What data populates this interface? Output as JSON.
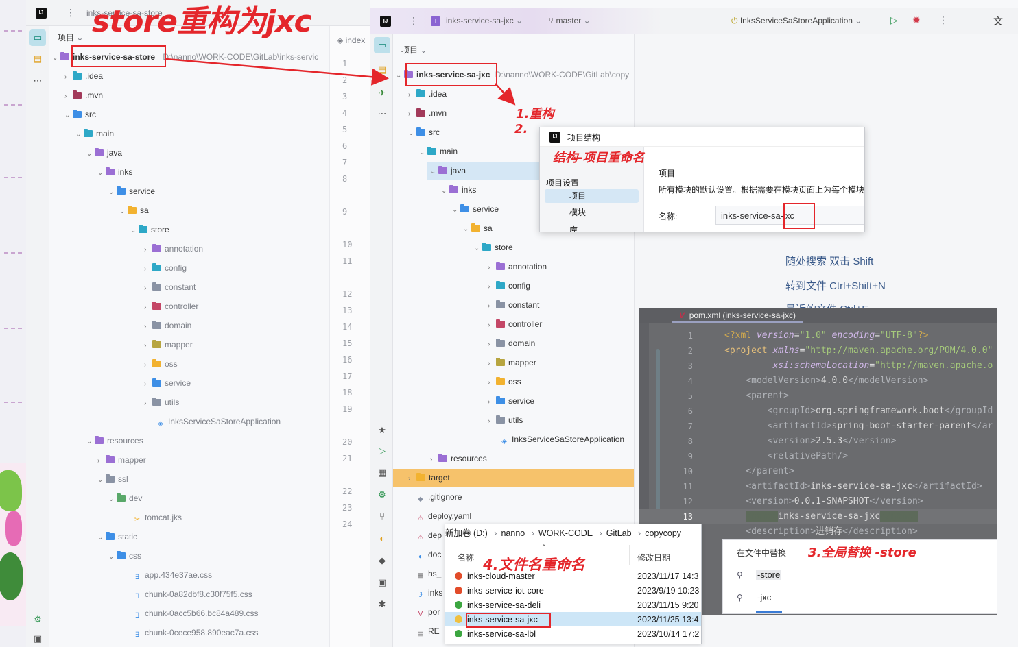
{
  "annotations": {
    "title": "store重构为jxc",
    "step1": "1.重构",
    "step2": "2.",
    "dialog_hint": "结构-项目重命名",
    "step3": "3.全局替换 -store",
    "step4": "4.文件名重命名"
  },
  "left_ide": {
    "project_name": "inks-service-sa-store",
    "project_path": "D:\\nanno\\WORK-CODE\\GitLab\\inks-servic",
    "panel_label": "项目",
    "tab_label": "index",
    "tree": [
      {
        "label": ".idea",
        "color": "#2ea8c7"
      },
      {
        "label": ".mvn",
        "color": "#a23a5a"
      },
      {
        "label": "src",
        "color": "#3e8fe6"
      },
      {
        "label": "main",
        "color": "#2ea8c7"
      },
      {
        "label": "java",
        "color": "#9b6fd4"
      },
      {
        "label": "inks",
        "color": "#9b6fd4"
      },
      {
        "label": "service",
        "color": "#3e8fe6"
      },
      {
        "label": "sa",
        "color": "#f2b230"
      },
      {
        "label": "store",
        "color": "#2ea8c7"
      },
      {
        "label": "annotation",
        "color": "#9b6fd4"
      },
      {
        "label": "config",
        "color": "#2ea8c7"
      },
      {
        "label": "constant",
        "color": "#8a93a4"
      },
      {
        "label": "controller",
        "color": "#c44767"
      },
      {
        "label": "domain",
        "color": "#8a93a4"
      },
      {
        "label": "mapper",
        "color": "#b7a540"
      },
      {
        "label": "oss",
        "color": "#f2b230"
      },
      {
        "label": "service",
        "color": "#3e8fe6"
      },
      {
        "label": "utils",
        "color": "#8a93a4"
      },
      {
        "label": "InksServiceSaStoreApplication",
        "color": "#3e8fe6"
      },
      {
        "label": "resources",
        "color": "#9b6fd4"
      },
      {
        "label": "mapper",
        "color": "#9b6fd4"
      },
      {
        "label": "ssl",
        "color": "#8a93a4"
      },
      {
        "label": "dev",
        "color": "#59a869"
      },
      {
        "label": "tomcat.jks",
        "color": "#f2b230"
      },
      {
        "label": "static",
        "color": "#3e8fe6"
      },
      {
        "label": "css",
        "color": "#3e8fe6"
      },
      {
        "label": "app.434e37ae.css",
        "color": "#3e8fe6"
      },
      {
        "label": "chunk-0a82dbf8.c30f75f5.css",
        "color": "#3e8fe6"
      },
      {
        "label": "chunk-0acc5b66.bc84a489.css",
        "color": "#3e8fe6"
      },
      {
        "label": "chunk-0cece958.890eac7a.css",
        "color": "#3e8fe6"
      }
    ],
    "line_numbers": [
      "1",
      "2",
      "3",
      "4",
      "5",
      "6",
      "7",
      "8",
      "9",
      "10",
      "11",
      "12",
      "13",
      "14",
      "15",
      "16",
      "17",
      "18",
      "19",
      "20",
      "21",
      "22",
      "23",
      "24"
    ]
  },
  "right_ide": {
    "project_chip": "inks-service-sa-jxc",
    "branch": "master",
    "run_config": "InksServiceSaStoreApplication",
    "panel_label": "项目",
    "project_name": "inks-service-sa-jxc",
    "project_path": "D:\\nanno\\WORK-CODE\\GitLab\\copy",
    "tree": [
      {
        "label": ".idea",
        "color": "#2ea8c7"
      },
      {
        "label": ".mvn",
        "color": "#a23a5a"
      },
      {
        "label": "src",
        "color": "#3e8fe6"
      },
      {
        "label": "main",
        "color": "#2ea8c7"
      },
      {
        "label": "java",
        "color": "#9b6fd4"
      },
      {
        "label": "inks",
        "color": "#9b6fd4"
      },
      {
        "label": "service",
        "color": "#3e8fe6"
      },
      {
        "label": "sa",
        "color": "#f2b230"
      },
      {
        "label": "store",
        "color": "#2ea8c7"
      },
      {
        "label": "annotation",
        "color": "#9b6fd4"
      },
      {
        "label": "config",
        "color": "#2ea8c7"
      },
      {
        "label": "constant",
        "color": "#8a93a4"
      },
      {
        "label": "controller",
        "color": "#c44767"
      },
      {
        "label": "domain",
        "color": "#8a93a4"
      },
      {
        "label": "mapper",
        "color": "#b7a540"
      },
      {
        "label": "oss",
        "color": "#f2b230"
      },
      {
        "label": "service",
        "color": "#3e8fe6"
      },
      {
        "label": "utils",
        "color": "#8a93a4"
      },
      {
        "label": "InksServiceSaStoreApplication",
        "color": "#3e8fe6"
      },
      {
        "label": "resources",
        "color": "#9b6fd4"
      },
      {
        "label": "target",
        "color": "#f2b230"
      },
      {
        "label": ".gitignore",
        "color": "#8a93a4"
      },
      {
        "label": "deploy.yaml",
        "color": "#c44767"
      },
      {
        "label": "dep",
        "color": "#c44767"
      },
      {
        "label": "doc",
        "color": "#3e8fe6"
      },
      {
        "label": "hs_",
        "color": "#555555"
      },
      {
        "label": "inks",
        "color": "#3e8fe6"
      },
      {
        "label": "por",
        "color": "#c44767"
      },
      {
        "label": "RE",
        "color": "#555555"
      }
    ],
    "hints": [
      "随处搜索 双击 Shift",
      "转到文件 Ctrl+Shift+N",
      "最近的文件 Ctrl+E"
    ]
  },
  "dialog": {
    "title": "项目结构",
    "section": "项目设置",
    "items": [
      "项目",
      "模块",
      "库"
    ],
    "heading": "项目",
    "desc": "所有模块的默认设置。根据需要在模块页面上为每个模块",
    "name_label": "名称:",
    "name_value": "inks-service-sa-jxc"
  },
  "pom": {
    "tab": "pom.xml (inks-service-sa-jxc)",
    "line_numbers": [
      "1",
      "2",
      "3",
      "4",
      "5",
      "6",
      "7",
      "8",
      "9",
      "10",
      "11",
      "12",
      "13"
    ]
  },
  "replace": {
    "title": "在文件中替换",
    "find": "-store",
    "replace": "-jxc"
  },
  "explorer": {
    "breadcrumb": [
      "新加卷 (D:)",
      "nanno",
      "WORK-CODE",
      "GitLab",
      "copycopy"
    ],
    "col_name": "名称",
    "col_date": "修改日期",
    "rows": [
      {
        "name": "inks-cloud-master",
        "date": "2023/11/17 14:3",
        "status": "#e24c2a"
      },
      {
        "name": "inks-service-iot-core",
        "date": "2023/9/19 10:23",
        "status": "#e24c2a"
      },
      {
        "name": "inks-service-sa-deli",
        "date": "2023/11/15 9:20",
        "status": "#3ca640"
      },
      {
        "name": "inks-service-sa-jxc",
        "date": "2023/11/25 13:4",
        "status": "#f0c040"
      },
      {
        "name": "inks-service-sa-lbl",
        "date": "2023/10/14 17:2",
        "status": "#3ca640"
      }
    ]
  }
}
